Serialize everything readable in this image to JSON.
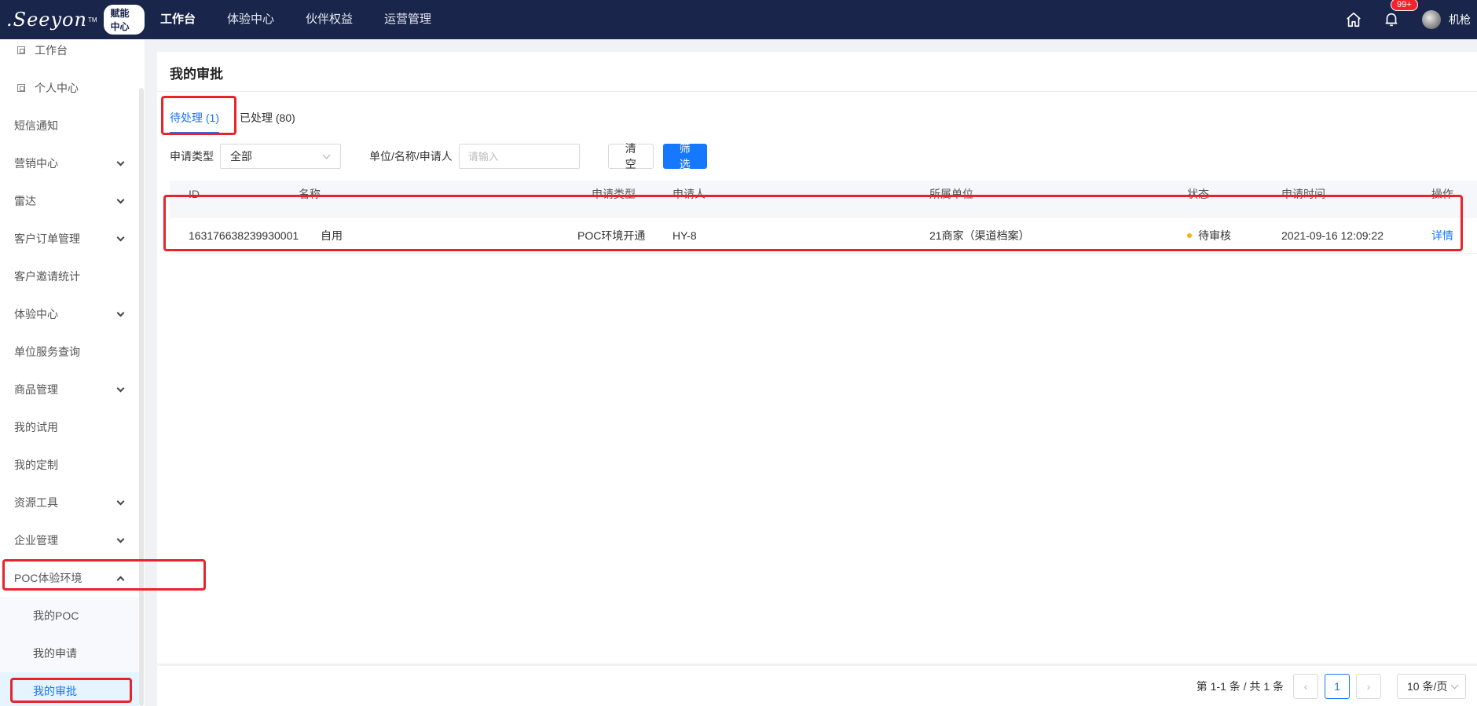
{
  "topbar": {
    "logo_text": ".Seeyon",
    "logo_tm": "TM",
    "logo_badge": "赋能中心",
    "nav": [
      {
        "label": "工作台",
        "active": true
      },
      {
        "label": "体验中心"
      },
      {
        "label": "伙伴权益"
      },
      {
        "label": "运营管理"
      }
    ],
    "notification_count": "99+",
    "username": "机枪"
  },
  "sidebar": {
    "items": [
      {
        "label": "工作台",
        "icon": "page-icon"
      },
      {
        "label": "个人中心",
        "icon": "page-icon"
      },
      {
        "label": "短信通知"
      },
      {
        "label": "营销中心",
        "expandable": true
      },
      {
        "label": "雷达",
        "expandable": true
      },
      {
        "label": "客户订单管理",
        "expandable": true
      },
      {
        "label": "客户邀请统计"
      },
      {
        "label": "体验中心",
        "expandable": true
      },
      {
        "label": "单位服务查询"
      },
      {
        "label": "商品管理",
        "expandable": true
      },
      {
        "label": "我的试用"
      },
      {
        "label": "我的定制"
      },
      {
        "label": "资源工具",
        "expandable": true
      },
      {
        "label": "企业管理",
        "expandable": true
      },
      {
        "label": "POC体验环境",
        "expanded": true
      }
    ],
    "sub_items": [
      {
        "label": "我的POC"
      },
      {
        "label": "我的申请"
      },
      {
        "label": "我的审批",
        "active": true
      }
    ]
  },
  "main": {
    "title": "我的审批",
    "tabs": [
      {
        "label": "待处理 (1)",
        "active": true
      },
      {
        "label": "已处理 (80)"
      }
    ],
    "filters": {
      "type_label": "申请类型",
      "type_value": "全部",
      "search_label": "单位/名称/申请人",
      "search_placeholder": "请输入",
      "clear_label": "清 空",
      "filter_label": "筛 选"
    },
    "table": {
      "headers": [
        "ID",
        "名称",
        "申请类型",
        "申请人",
        "所属单位",
        "状态",
        "申请时间",
        "操作"
      ],
      "rows": [
        {
          "id": "163176638239930001",
          "name": "自用",
          "type": "POC环境开通",
          "applicant": "HY-8",
          "unit": "21商家（渠道档案）",
          "status": "待审核",
          "time": "2021-09-16 12:09:22",
          "action": "详情"
        }
      ]
    }
  },
  "pagination": {
    "total_text": "第 1-1 条 / 共 1 条",
    "current_page": "1",
    "page_size": "10 条/页"
  },
  "colors": {
    "topbar": "#19254b",
    "primary": "#1677ff",
    "status_pending": "#faad14",
    "annotation": "#e8232b"
  }
}
